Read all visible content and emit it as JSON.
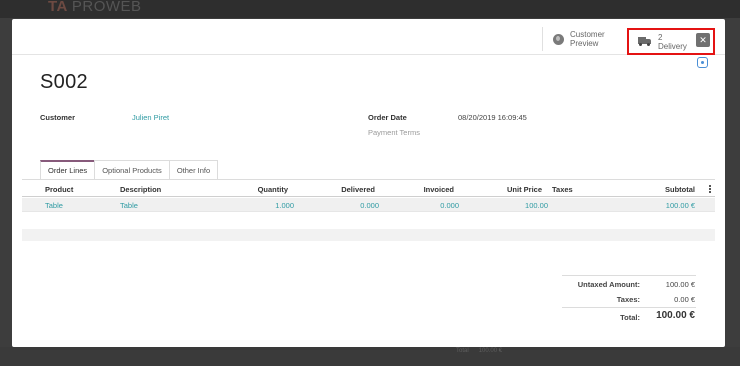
{
  "background": {
    "logo_mark": "TA",
    "brand": "PROWEB",
    "total_label": "Total",
    "total_value": "100.00 €"
  },
  "stat_buttons": {
    "customer_preview": {
      "line1": "Customer",
      "line2": "Preview",
      "icon": "globe-icon"
    },
    "delivery": {
      "count": "2",
      "label": "Delivery",
      "icon": "truck-icon"
    }
  },
  "record": {
    "name": "S002",
    "customer_label": "Customer",
    "customer_value": "Julien Piret",
    "order_date_label": "Order Date",
    "order_date_value": "08/20/2019 16:09:45",
    "payment_terms_label": "Payment Terms"
  },
  "tabs": [
    "Order Lines",
    "Optional Products",
    "Other Info"
  ],
  "table": {
    "headers": {
      "product": "Product",
      "description": "Description",
      "quantity": "Quantity",
      "delivered": "Delivered",
      "invoiced": "Invoiced",
      "unit_price": "Unit Price",
      "taxes": "Taxes",
      "subtotal": "Subtotal"
    },
    "rows": [
      {
        "product": "Table",
        "description": "Table",
        "quantity": "1.000",
        "delivered": "0.000",
        "invoiced": "0.000",
        "unit_price": "100.00",
        "taxes": "",
        "subtotal": "100.00 €"
      }
    ]
  },
  "totals": {
    "untaxed_label": "Untaxed Amount:",
    "untaxed_value": "100.00 €",
    "taxes_label": "Taxes:",
    "taxes_value": "0.00 €",
    "total_label": "Total:",
    "total_value": "100.00 €"
  },
  "colors": {
    "accent": "#875a7b",
    "link": "#2f9ba3",
    "highlight": "#e41313"
  }
}
